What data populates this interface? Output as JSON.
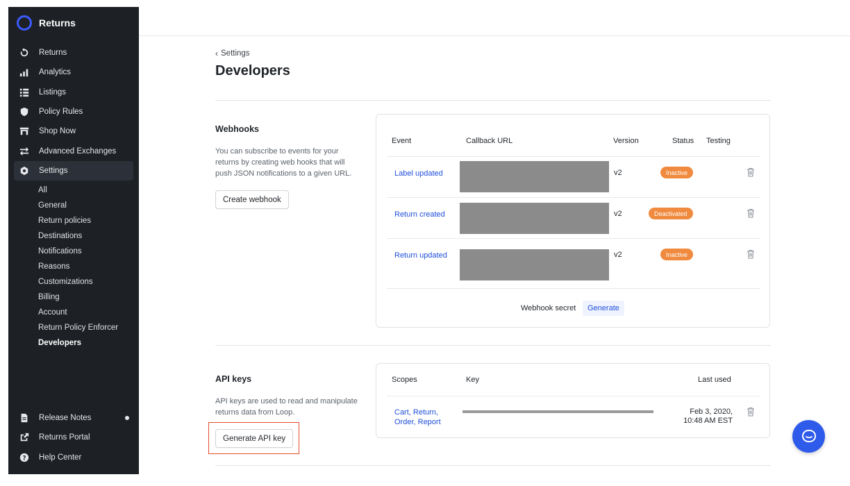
{
  "app": {
    "name": "Returns"
  },
  "sidebar": {
    "items": [
      {
        "label": "Returns",
        "icon": "returns-icon"
      },
      {
        "label": "Analytics",
        "icon": "analytics-icon"
      },
      {
        "label": "Listings",
        "icon": "listings-icon"
      },
      {
        "label": "Policy Rules",
        "icon": "shield-icon"
      },
      {
        "label": "Shop Now",
        "icon": "store-icon"
      },
      {
        "label": "Advanced Exchanges",
        "icon": "exchange-icon"
      },
      {
        "label": "Settings",
        "icon": "gear-icon",
        "active": true
      }
    ],
    "settings_sub": [
      "All",
      "General",
      "Return policies",
      "Destinations",
      "Notifications",
      "Reasons",
      "Customizations",
      "Billing",
      "Account",
      "Return Policy Enforcer",
      "Developers"
    ],
    "current_sub": "Developers",
    "bottom": [
      {
        "label": "Release Notes",
        "icon": "document-icon"
      },
      {
        "label": "Returns Portal",
        "icon": "external-link-icon"
      },
      {
        "label": "Help Center",
        "icon": "help-icon"
      }
    ]
  },
  "breadcrumb": {
    "label": "Settings"
  },
  "page": {
    "title": "Developers"
  },
  "webhooks": {
    "title": "Webhooks",
    "description": "You can subscribe to events for your returns by creating web hooks that will push JSON notifications to a given URL.",
    "create_label": "Create webhook",
    "columns": {
      "event": "Event",
      "callback": "Callback URL",
      "version": "Version",
      "status": "Status",
      "testing": "Testing"
    },
    "rows": [
      {
        "event": "Label updated",
        "version": "v2",
        "status": "Inactive"
      },
      {
        "event": "Return created",
        "version": "v2",
        "status": "Deactivated"
      },
      {
        "event": "Return updated",
        "version": "v2",
        "status": "Inactive"
      }
    ],
    "secret_label": "Webhook secret",
    "generate_label": "Generate"
  },
  "api_keys": {
    "title": "API keys",
    "description": "API keys are used to read and manipulate returns data from Loop.",
    "generate_label": "Generate API key",
    "columns": {
      "scopes": "Scopes",
      "key": "Key",
      "last_used": "Last used"
    },
    "rows": [
      {
        "scopes": "Cart, Return, Order, Report",
        "last_used_date": "Feb 3, 2020,",
        "last_used_time": "10:48 AM EST"
      }
    ]
  },
  "colors": {
    "accent": "#1f4ed8",
    "badge": "#f08a3e",
    "highlight": "#e54b2c",
    "sidebar": "#1d2025",
    "fab": "#2f5bea"
  }
}
